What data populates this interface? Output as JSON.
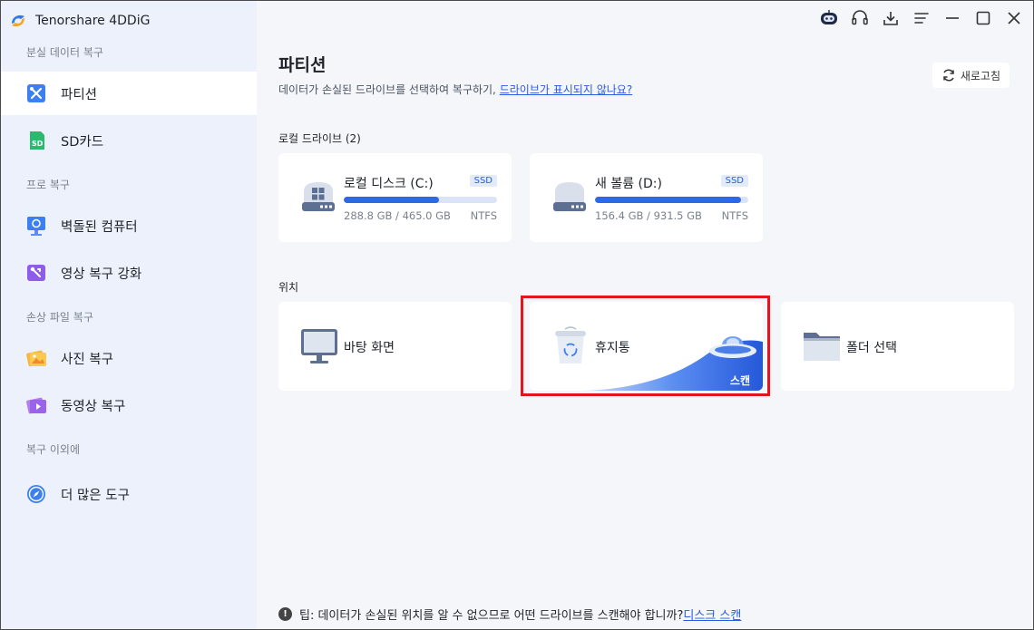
{
  "app": {
    "title": "Tenorshare 4DDiG"
  },
  "sidebar": {
    "sections": [
      {
        "label": "분실 데이터 복구"
      },
      {
        "label": "프로 복구"
      },
      {
        "label": "손상 파일 복구"
      },
      {
        "label": "복구 이외에"
      }
    ],
    "items": [
      {
        "label": "파티션",
        "icon": "partition-icon"
      },
      {
        "label": "SD카드",
        "icon": "sd-card-icon"
      },
      {
        "label": "벽돌된 컴퓨터",
        "icon": "crashed-computer-icon"
      },
      {
        "label": "영상 복구 강화",
        "icon": "video-repair-icon"
      },
      {
        "label": "사진 복구",
        "icon": "photo-icon"
      },
      {
        "label": "동영상 복구",
        "icon": "video-icon"
      },
      {
        "label": "더 많은 도구",
        "icon": "compass-icon"
      }
    ]
  },
  "main": {
    "title": "파티션",
    "subtitle": "데이터가 손실된 드라이브를 선택하여 복구하기,",
    "subtitle_link": "드라이브가 표시되지 않나요?",
    "refresh_label": "새로고침",
    "local_drives_label": "로컬 드라이브 (2)",
    "drives": [
      {
        "name": "로컬 디스크 (C:)",
        "badge": "SSD",
        "used": "288.8 GB / 465.0 GB",
        "fs": "NTFS",
        "usage": 0.62
      },
      {
        "name": "새 볼륨 (D:)",
        "badge": "SSD",
        "used": "156.4 GB / 931.5 GB",
        "fs": "NTFS",
        "usage": 0.95
      }
    ],
    "locations_label": "위치",
    "locations": [
      {
        "label": "바탕 화면"
      },
      {
        "label": "휴지통",
        "action": "스캔"
      },
      {
        "label": "폴더 선택"
      }
    ],
    "tip": "팁: 데이터가 손실된 위치를 알 수 없으므로 어떤 드라이브를 스캔해야 합니까?",
    "tip_link": "디스크 스캔"
  },
  "colors": {
    "accent": "#2f68e6",
    "highlight": "#e0151f",
    "link": "#2a5ae0"
  }
}
